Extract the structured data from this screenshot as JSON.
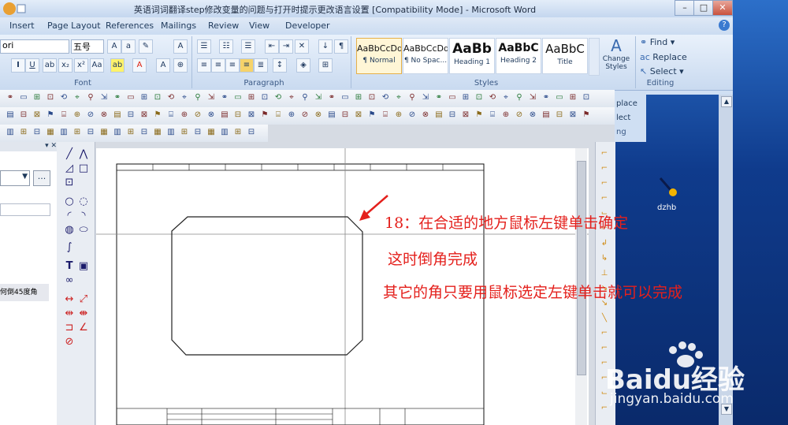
{
  "window": {
    "title": "英语词词翻译step修改变量的问题与打开时提示更改语言设置 [Compatibility Mode] - Microsoft Word",
    "controls": {
      "minimize": "–",
      "maximize": "□",
      "close": "✕"
    }
  },
  "ribbon": {
    "tabs": [
      "Insert",
      "Page Layout",
      "References",
      "Mailings",
      "Review",
      "View",
      "Developer"
    ],
    "font": {
      "name": "ori",
      "size": "五号",
      "group_label": "Font"
    },
    "paragraph": {
      "group_label": "Paragraph"
    },
    "styles": {
      "group_label": "Styles",
      "items": [
        {
          "preview": "AaBbCcDd",
          "name": "¶ Normal"
        },
        {
          "preview": "AaBbCcDd",
          "name": "¶ No Spac..."
        },
        {
          "preview": "AaBb",
          "name": "Heading 1"
        },
        {
          "preview": "AaBbC",
          "name": "Heading 2"
        },
        {
          "preview": "AaBbC",
          "name": "Title"
        }
      ],
      "change_styles": "Change Styles"
    },
    "editing": {
      "group_label": "Editing",
      "find": "Find",
      "replace": "Replace",
      "select": "Select"
    }
  },
  "side_pane": {
    "replace_partial": "place",
    "select_partial": "lect",
    "editing_partial": "ng"
  },
  "left_panel": {
    "item_text": "何倒45度角"
  },
  "annotation": {
    "step": "18：在合适的地方鼠标左键单击确定",
    "line2": "这时倒角完成",
    "line3": "其它的角只要用鼠标选定左键单击就可以完成"
  },
  "desktop": {
    "icon_label": "dzhb"
  },
  "watermark": {
    "brand": "Baidu经验",
    "url": "jingyan.baidu.com"
  },
  "colors": {
    "annotation": "#e4201c",
    "ribbon": "#cfdff3",
    "desktop": "#0f3b8c"
  }
}
